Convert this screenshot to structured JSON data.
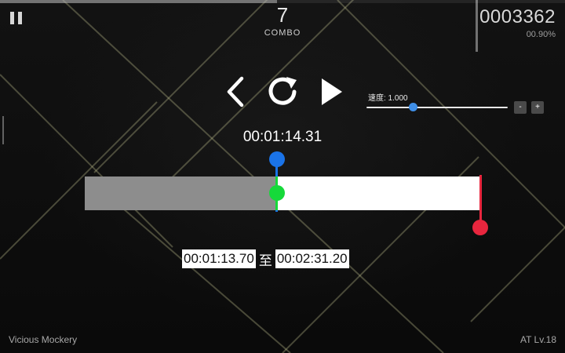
{
  "hud": {
    "combo_value": "7",
    "combo_label": "COMBO",
    "score": "0003362",
    "accuracy": "00.90%",
    "song_progress": 0.49,
    "song_title": "Vicious Mockery",
    "level": "AT Lv.18"
  },
  "controls": {
    "speed_label": "速度: 1.000",
    "speed_fraction": 0.33,
    "speed_decrease": "-",
    "speed_increase": "+"
  },
  "timeline": {
    "current_time": "00:01:14.31",
    "current_fraction": 0.486,
    "start_fraction": 0.486,
    "end_fraction": 1.0,
    "range_start": "00:01:13.70",
    "range_separator": "至",
    "range_end": "00:02:31.20"
  },
  "colors": {
    "current_marker": "#1a73e8",
    "start_marker": "#16d93a",
    "end_marker": "#e8263e",
    "played": "#8d8d8d",
    "unplayed": "#ffffff"
  },
  "icons": {
    "pause": "pause-icon",
    "back": "chevron-left-icon",
    "restart": "restart-icon",
    "play": "play-icon"
  }
}
